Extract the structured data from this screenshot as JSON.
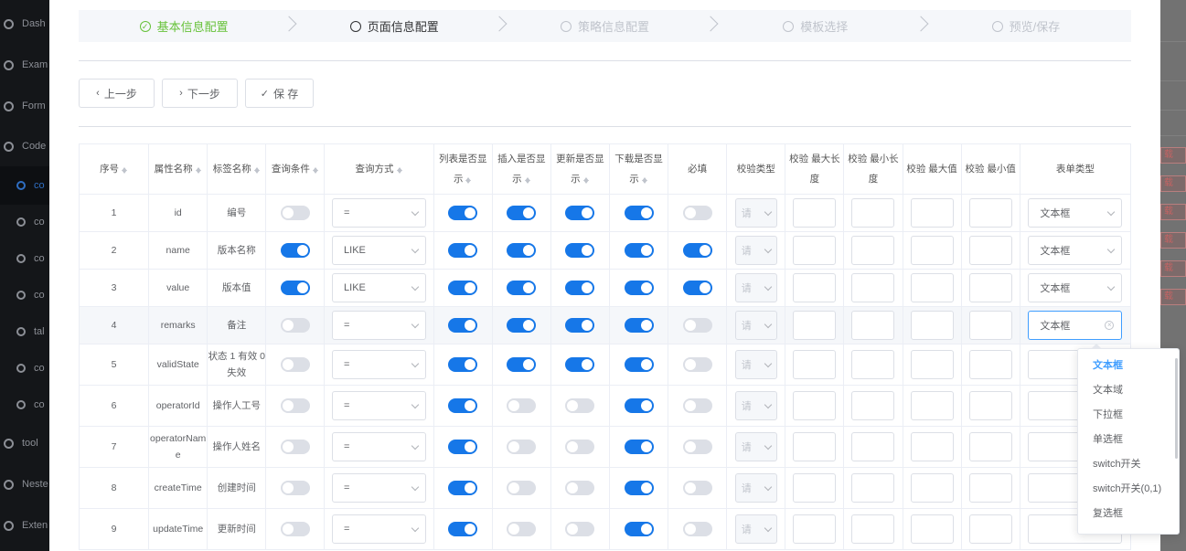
{
  "sidebar": {
    "items": [
      {
        "label": "Dash",
        "icon": "dashboard-icon"
      },
      {
        "label": "Exam",
        "icon": "circle-icon"
      },
      {
        "label": "Form",
        "icon": "form-icon"
      },
      {
        "label": "Code",
        "icon": "circle-icon"
      },
      {
        "label": "co",
        "icon": "circle-icon",
        "sub": true,
        "active": true
      },
      {
        "label": "co",
        "icon": "circle-icon",
        "sub": true
      },
      {
        "label": "co",
        "icon": "circle-icon",
        "sub": true
      },
      {
        "label": "co",
        "icon": "circle-icon",
        "sub": true
      },
      {
        "label": "tal",
        "icon": "circle-icon",
        "sub": true
      },
      {
        "label": "co",
        "icon": "circle-icon",
        "sub": true
      },
      {
        "label": "co",
        "icon": "circle-icon",
        "sub": true
      },
      {
        "label": "tool",
        "icon": "circle-icon"
      },
      {
        "label": "Neste",
        "icon": "list-icon"
      },
      {
        "label": "Exten",
        "icon": "external-link-icon"
      }
    ]
  },
  "right_buttons": [
    "载",
    "载",
    "载",
    "载",
    "载",
    "载"
  ],
  "steps": [
    {
      "label": "基本信息配置",
      "state": "done"
    },
    {
      "label": "页面信息配置",
      "state": "current"
    },
    {
      "label": "策略信息配置",
      "state": "wait"
    },
    {
      "label": "模板选择",
      "state": "wait"
    },
    {
      "label": "预览/保存",
      "state": "wait"
    }
  ],
  "actions": {
    "prev": {
      "icon": "‹",
      "label": "上一步"
    },
    "next": {
      "icon": "›",
      "label": "下一步"
    },
    "save": {
      "icon": "✓",
      "label": "保 存"
    }
  },
  "table": {
    "headers": [
      "序号",
      "属性名称",
      "标签名称",
      "查询条件",
      "查询方式",
      "列表是否显示",
      "插入是否显示",
      "更新是否显示",
      "下载是否显示",
      "必填",
      "校验类型",
      "校验 最大长度",
      "校验 最小长度",
      "校验 最大值",
      "校验 最小值",
      "表单类型"
    ],
    "validate_placeholder": "请",
    "rows": [
      {
        "idx": "1",
        "attr": "id",
        "label": "编号",
        "query": false,
        "method": "=",
        "list": true,
        "insert": true,
        "update": true,
        "download": true,
        "required": false,
        "form": "文本框"
      },
      {
        "idx": "2",
        "attr": "name",
        "label": "版本名称",
        "query": true,
        "method": "LIKE",
        "list": true,
        "insert": true,
        "update": true,
        "download": true,
        "required": true,
        "form": "文本框"
      },
      {
        "idx": "3",
        "attr": "value",
        "label": "版本值",
        "query": true,
        "method": "LIKE",
        "list": true,
        "insert": true,
        "update": true,
        "download": true,
        "required": true,
        "form": "文本框"
      },
      {
        "idx": "4",
        "attr": "remarks",
        "label": "备注",
        "query": false,
        "method": "=",
        "list": true,
        "insert": true,
        "update": true,
        "download": true,
        "required": false,
        "form": "文本框",
        "focused": true
      },
      {
        "idx": "5",
        "attr": "validState",
        "label": "状态 1 有效 0 失效",
        "query": false,
        "method": "=",
        "list": true,
        "insert": true,
        "update": true,
        "download": true,
        "required": false,
        "form": ""
      },
      {
        "idx": "6",
        "attr": "operatorId",
        "label": "操作人工号",
        "query": false,
        "method": "=",
        "list": true,
        "insert": false,
        "update": false,
        "download": true,
        "required": false,
        "form": ""
      },
      {
        "idx": "7",
        "attr": "operatorName",
        "label": "操作人姓名",
        "query": false,
        "method": "=",
        "list": true,
        "insert": false,
        "update": false,
        "download": true,
        "required": false,
        "form": ""
      },
      {
        "idx": "8",
        "attr": "createTime",
        "label": "创建时间",
        "query": false,
        "method": "=",
        "list": true,
        "insert": false,
        "update": false,
        "download": true,
        "required": false,
        "form": ""
      },
      {
        "idx": "9",
        "attr": "updateTime",
        "label": "更新时间",
        "query": false,
        "method": "=",
        "list": true,
        "insert": false,
        "update": false,
        "download": true,
        "required": false,
        "form": ""
      }
    ]
  },
  "dropdown": {
    "options": [
      "文本框",
      "文本域",
      "下拉框",
      "单选框",
      "switch开关",
      "switch开关(0,1)",
      "复选框"
    ],
    "selected": "文本框"
  }
}
